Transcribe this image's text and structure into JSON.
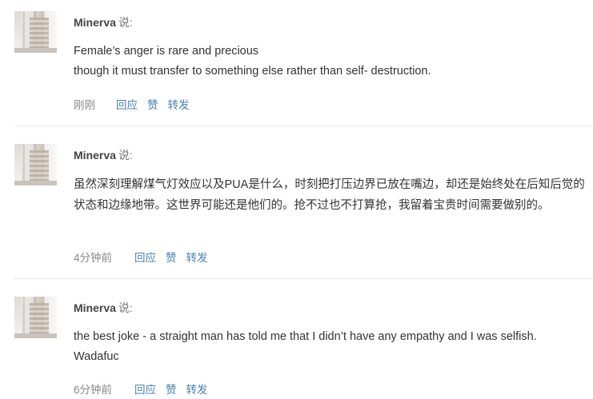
{
  "comments": [
    {
      "author": "Minerva",
      "says": "说:",
      "lines": [
        "Female’s anger is rare and precious",
        "though it must transfer to something else rather than self- destruction."
      ],
      "time": "刚刚",
      "actions": [
        "回应",
        "赞",
        "转发"
      ]
    },
    {
      "author": "Minerva",
      "says": "说:",
      "lines": [
        "虽然深刻理解煤气灯效应以及PUA是什么，时刻把打压边界已放在嘴边，却还是始终处在后知后觉的状态和边缘地带。这世界可能还是他们的。抢不过也不打算抢，我留着宝贵时间需要做别的。"
      ],
      "time": "4分钟前",
      "actions": [
        "回应",
        "赞",
        "转发"
      ]
    },
    {
      "author": "Minerva",
      "says": "说:",
      "lines": [
        "the best joke - a straight man has told me that I didn’t have any empathy and I was selfish.",
        "Wadafuc"
      ],
      "time": "6分钟前",
      "actions": [
        "回应",
        "赞",
        "转发"
      ]
    }
  ]
}
